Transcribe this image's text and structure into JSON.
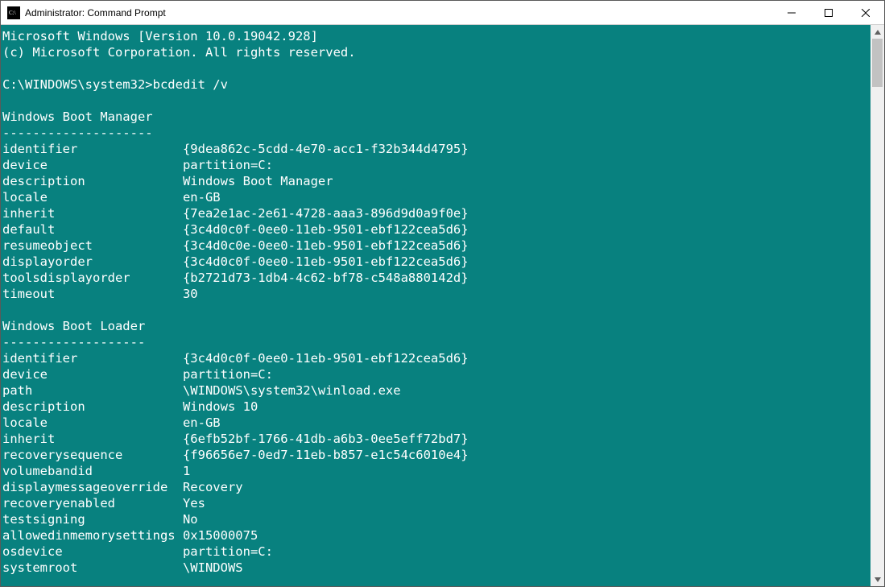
{
  "window": {
    "title": "Administrator: Command Prompt"
  },
  "banner": {
    "line1": "Microsoft Windows [Version 10.0.19042.928]",
    "line2": "(c) Microsoft Corporation. All rights reserved."
  },
  "prompt": {
    "path": "C:\\WINDOWS\\system32>",
    "command": "bcdedit /v"
  },
  "sections": [
    {
      "title": "Windows Boot Manager",
      "sep": "--------------------",
      "rows": [
        {
          "k": "identifier",
          "v": "{9dea862c-5cdd-4e70-acc1-f32b344d4795}"
        },
        {
          "k": "device",
          "v": "partition=C:"
        },
        {
          "k": "description",
          "v": "Windows Boot Manager"
        },
        {
          "k": "locale",
          "v": "en-GB"
        },
        {
          "k": "inherit",
          "v": "{7ea2e1ac-2e61-4728-aaa3-896d9d0a9f0e}"
        },
        {
          "k": "default",
          "v": "{3c4d0c0f-0ee0-11eb-9501-ebf122cea5d6}"
        },
        {
          "k": "resumeobject",
          "v": "{3c4d0c0e-0ee0-11eb-9501-ebf122cea5d6}"
        },
        {
          "k": "displayorder",
          "v": "{3c4d0c0f-0ee0-11eb-9501-ebf122cea5d6}"
        },
        {
          "k": "toolsdisplayorder",
          "v": "{b2721d73-1db4-4c62-bf78-c548a880142d}"
        },
        {
          "k": "timeout",
          "v": "30"
        }
      ]
    },
    {
      "title": "Windows Boot Loader",
      "sep": "-------------------",
      "rows": [
        {
          "k": "identifier",
          "v": "{3c4d0c0f-0ee0-11eb-9501-ebf122cea5d6}"
        },
        {
          "k": "device",
          "v": "partition=C:"
        },
        {
          "k": "path",
          "v": "\\WINDOWS\\system32\\winload.exe"
        },
        {
          "k": "description",
          "v": "Windows 10"
        },
        {
          "k": "locale",
          "v": "en-GB"
        },
        {
          "k": "inherit",
          "v": "{6efb52bf-1766-41db-a6b3-0ee5eff72bd7}"
        },
        {
          "k": "recoverysequence",
          "v": "{f96656e7-0ed7-11eb-b857-e1c54c6010e4}"
        },
        {
          "k": "volumebandid",
          "v": "1"
        },
        {
          "k": "displaymessageoverride",
          "v": "Recovery"
        },
        {
          "k": "recoveryenabled",
          "v": "Yes"
        },
        {
          "k": "testsigning",
          "v": "No"
        },
        {
          "k": "allowedinmemorysettings",
          "v": "0x15000075"
        },
        {
          "k": "osdevice",
          "v": "partition=C:"
        },
        {
          "k": "systemroot",
          "v": "\\WINDOWS"
        }
      ]
    }
  ]
}
